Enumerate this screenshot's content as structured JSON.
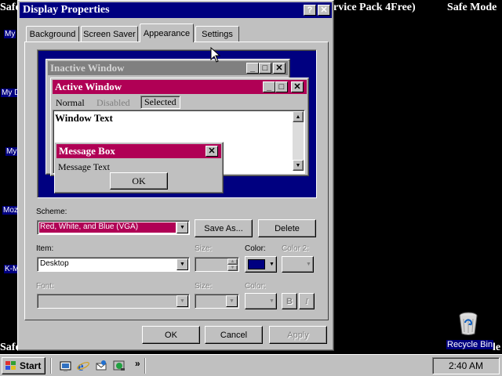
{
  "desktop": {
    "top_left_text": "Safe",
    "top_middle_text": "rvice Pack 4Free)",
    "top_right_text": "Safe Mode",
    "bottom_left_text": "Safe",
    "bottom_right_text": "le",
    "icon_labels": [
      "My",
      "My D",
      "My",
      "Moz",
      "K-M"
    ],
    "recycle_bin_label": "Recycle Bin"
  },
  "dialog": {
    "title": "Display Properties",
    "help_button": "?",
    "close_button": "✕",
    "tabs": [
      {
        "label": "Background",
        "selected": false
      },
      {
        "label": "Screen Saver",
        "selected": false
      },
      {
        "label": "Appearance",
        "selected": true
      },
      {
        "label": "Settings",
        "selected": false
      }
    ],
    "preview": {
      "inactive_title": "Inactive Window",
      "active_title": "Active Window",
      "menu": {
        "normal": "Normal",
        "disabled": "Disabled",
        "selected": "Selected"
      },
      "window_text": "Window Text",
      "message_title": "Message Box",
      "message_text": "Message Text",
      "ok_label": "OK"
    },
    "scheme": {
      "label": "Scheme:",
      "value": "Red, White, and Blue (VGA)",
      "save_as_label": "Save As...",
      "delete_label": "Delete"
    },
    "item": {
      "label": "Item:",
      "value": "Desktop",
      "size_label": "Size:",
      "color_label": "Color:",
      "color2_label": "Color 2:",
      "color_value": "#000080"
    },
    "font": {
      "label": "Font:",
      "size_label": "Size:",
      "color_label": "Color:",
      "bold_label": "B",
      "italic_label": "I"
    },
    "buttons": {
      "ok": "OK",
      "cancel": "Cancel",
      "apply": "Apply"
    }
  },
  "taskbar": {
    "start_label": "Start",
    "chevron": "»",
    "clock": "2:40 AM"
  },
  "colors": {
    "desktop": "#000000",
    "active_title": "#b00055",
    "dialog_title": "#000080",
    "preview_desktop": "#000080"
  }
}
